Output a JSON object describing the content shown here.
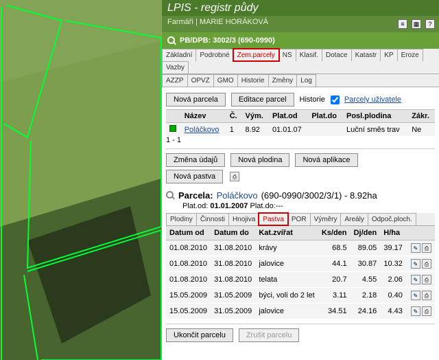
{
  "header": {
    "title": "LPIS - registr půdy",
    "breadcrumb": "Farmáři | MARIE HORÁKOVÁ",
    "section": "PB/DPB: 3002/3 (690-0990)"
  },
  "tabs1": [
    "Základní",
    "Podrobné",
    "Zem.parcely",
    "NS",
    "Klasif.",
    "Dotace",
    "Katastr",
    "KP",
    "Eroze",
    "Vazby"
  ],
  "tabs1_highlight_index": 2,
  "tabs2": [
    "AZZP",
    "OPVZ",
    "GMO",
    "Historie",
    "Změny",
    "Log"
  ],
  "toolbar1": {
    "new": "Nová parcela",
    "edit": "Editace parcel",
    "history": "Historie",
    "users": "Parcely uživatele"
  },
  "table1": {
    "headers": [
      "",
      "Název",
      "Č.",
      "Vým.",
      "Plat.od",
      "Plat.do",
      "Posl.plodina",
      "Zákr."
    ],
    "row": {
      "name": "Poláčkovo",
      "num": "1",
      "area": "8.92",
      "from": "01.01.07",
      "to": "",
      "crop": "Luční směs trav",
      "close": "Ne"
    },
    "footer": "1 - 1"
  },
  "toolbar2": {
    "change": "Změna údajů",
    "crop": "Nová plodina",
    "app": "Nová aplikace",
    "graze": "Nová pastva"
  },
  "parcela": {
    "label": "Parcela:",
    "name": "Poláčkovo",
    "detail": "(690-0990/3002/3/1) - 8.92ha",
    "validfrom_label": "Plat.od:",
    "validfrom": "01.01.2007",
    "validto_label": "Plat.do:",
    "validto": "---"
  },
  "tabs3": [
    "Plodiny",
    "Činnosti",
    "Hnojiva",
    "Pastva",
    "POR",
    "Výměry",
    "Areály",
    "Odpoč.ploch."
  ],
  "tabs3_highlight_index": 3,
  "grazing": {
    "headers": [
      "Datum od",
      "Datum do",
      "Kat.zvířat",
      "Ks/den",
      "Dj/den",
      "H/ha"
    ],
    "rows": [
      {
        "from": "01.08.2010",
        "to": "31.08.2010",
        "cat": "krávy",
        "ks": "68.5",
        "dj": "89.05",
        "h": "39.17"
      },
      {
        "from": "01.08.2010",
        "to": "31.08.2010",
        "cat": "jalovice",
        "ks": "44.1",
        "dj": "30.87",
        "h": "10.32"
      },
      {
        "from": "01.08.2010",
        "to": "31.08.2010",
        "cat": "telata",
        "ks": "20.7",
        "dj": "4.55",
        "h": "2.06"
      },
      {
        "from": "15.05.2009",
        "to": "31.05.2009",
        "cat": "býci, voli do 2 let",
        "ks": "3.11",
        "dj": "2.18",
        "h": "0.40"
      },
      {
        "from": "15.05.2009",
        "to": "31.05.2009",
        "cat": "jalovice",
        "ks": "34.51",
        "dj": "24.16",
        "h": "4.43"
      }
    ]
  },
  "footer_btns": {
    "end": "Ukončit parcelu",
    "cancel": "Zrušit parcelu"
  }
}
